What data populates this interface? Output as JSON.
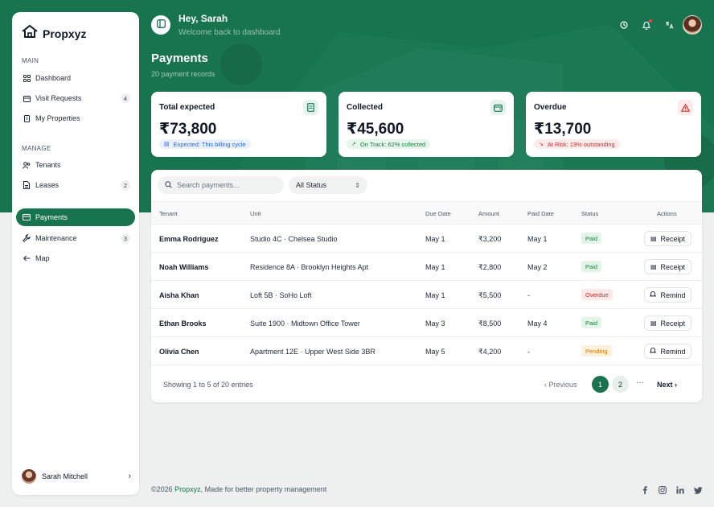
{
  "brand": {
    "name": "Propxyz"
  },
  "sidebar": {
    "sections": [
      {
        "label": "MAIN",
        "items": [
          {
            "label": "Dashboard",
            "icon": "grid-icon",
            "badge": ""
          },
          {
            "label": "Visit Requests",
            "icon": "calendar-icon",
            "badge": "4"
          },
          {
            "label": "My Properties",
            "icon": "building-icon",
            "badge": ""
          }
        ]
      },
      {
        "label": "MANAGE",
        "items": [
          {
            "label": "Tenants",
            "icon": "users-icon",
            "badge": ""
          },
          {
            "label": "Leases",
            "icon": "file-icon",
            "badge": "2"
          },
          {
            "label": "Payments",
            "icon": "card-icon",
            "badge": "",
            "active": true
          },
          {
            "label": "Maintenance",
            "icon": "wrench-icon",
            "badge": "3"
          },
          {
            "label": "Map",
            "icon": "arrow-left-icon",
            "badge": ""
          }
        ]
      }
    ],
    "user": {
      "name": "Sarah Mitchell"
    }
  },
  "header": {
    "greeting": "Hey, Sarah",
    "subtitle": "Welcome back to dashboard",
    "icons": [
      "clock-icon",
      "bell-icon",
      "translate-icon"
    ]
  },
  "page": {
    "title": "Payments",
    "subtitle": "20 payment records"
  },
  "stats": [
    {
      "label": "Total expected",
      "value": "₹73,800",
      "tag": "Expected: This billing cycle",
      "tag_color": "#2563eb",
      "tag_bg": "#e8f1fd",
      "icon": "receipt-icon",
      "icon_color": "#17744f",
      "icon_bg": "#e6f3ec"
    },
    {
      "label": "Collected",
      "value": "₹45,600",
      "tag": "On Track: 62% collected",
      "tag_color": "#15803d",
      "tag_bg": "#e7f6ec",
      "icon": "wallet-icon",
      "icon_color": "#17744f",
      "icon_bg": "#e6f3ec"
    },
    {
      "label": "Overdue",
      "value": "₹13,700",
      "tag": "At Risk: 19% outstanding",
      "tag_color": "#dc2626",
      "tag_bg": "#fdeaea",
      "icon": "alert-icon",
      "icon_color": "#dc2626",
      "icon_bg": "#fdeaea"
    }
  ],
  "filters": {
    "search_placeholder": "Search payments...",
    "status_value": "All Status"
  },
  "table": {
    "columns": [
      "Tenant",
      "Unit",
      "Due Date",
      "Amount",
      "Paid Date",
      "Status",
      "Actions"
    ],
    "rows": [
      {
        "tenant": "Emma Rodriguez",
        "unit": "Studio 4C · Chelsea Studio",
        "due": "May 1",
        "amount": "₹3,200",
        "paid": "May 1",
        "status": "Paid",
        "action": "Receipt"
      },
      {
        "tenant": "Noah Williams",
        "unit": "Residence 8A · Brooklyn Heights Apt",
        "due": "May 1",
        "amount": "₹2,800",
        "paid": "May 2",
        "status": "Paid",
        "action": "Receipt"
      },
      {
        "tenant": "Aisha Khan",
        "unit": "Loft 5B · SoHo Loft",
        "due": "May 1",
        "amount": "₹5,500",
        "paid": "-",
        "status": "Overdue",
        "action": "Remind"
      },
      {
        "tenant": "Ethan Brooks",
        "unit": "Suite 1900 · Midtown Office Tower",
        "due": "May 3",
        "amount": "₹8,500",
        "paid": "May 4",
        "status": "Paid",
        "action": "Receipt"
      },
      {
        "tenant": "Olivia Chen",
        "unit": "Apartment 12E · Upper West Side 3BR",
        "due": "May 5",
        "amount": "₹4,200",
        "paid": "-",
        "status": "Pending",
        "action": "Remind"
      }
    ],
    "status_styles": {
      "Paid": {
        "color": "#15803d",
        "bg": "#e3f5e9"
      },
      "Overdue": {
        "color": "#dc2626",
        "bg": "#fde8e8"
      },
      "Pending": {
        "color": "#d97706",
        "bg": "#fdf0dc"
      }
    }
  },
  "pagination": {
    "showing": "Showing 1 to 5 of 20 entries",
    "prev": "Previous",
    "pages": [
      "1",
      "2"
    ],
    "current": "1",
    "ellipsis": "···",
    "next": "Next"
  },
  "footer": {
    "copyright_prefix": "©2026 ",
    "brand": "Propxyz",
    "copyright_suffix": ", Made for better property management",
    "social": [
      "facebook-icon",
      "instagram-icon",
      "linkedin-icon",
      "twitter-icon"
    ]
  },
  "colors": {
    "brand": "#17744f",
    "background": "#eef0ef"
  }
}
